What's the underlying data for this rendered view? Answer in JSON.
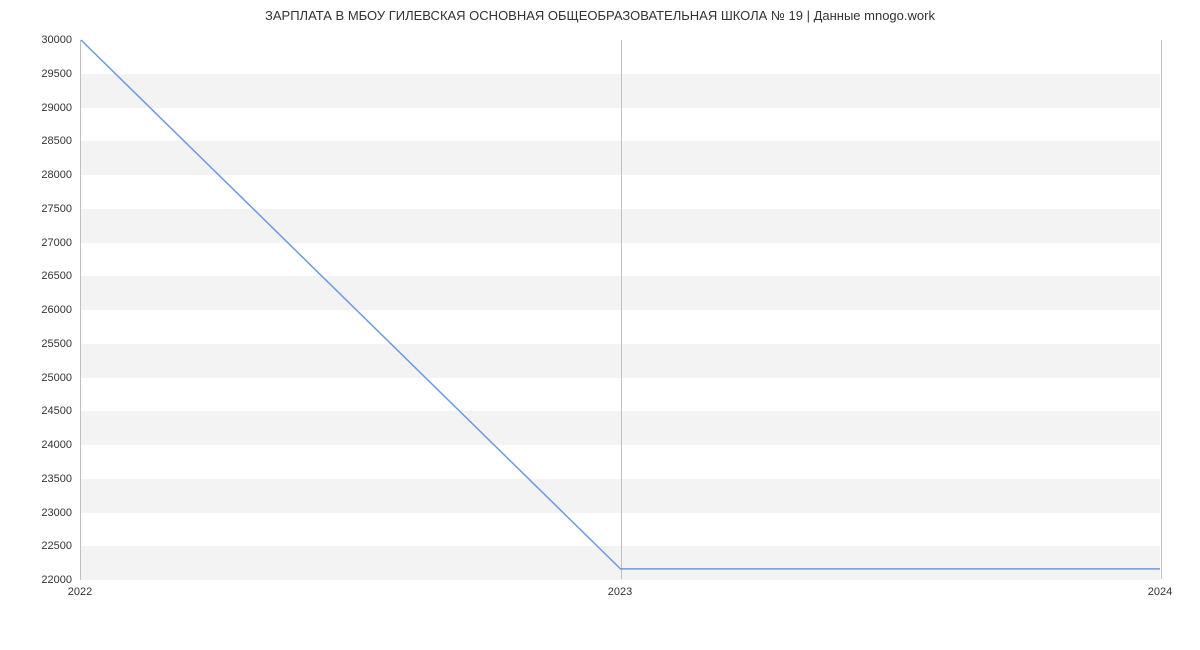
{
  "chart_data": {
    "type": "line",
    "title": "ЗАРПЛАТА В МБОУ ГИЛЕВСКАЯ ОСНОВНАЯ ОБЩЕОБРАЗОВАТЕЛЬНАЯ ШКОЛА № 19 | Данные mnogo.work",
    "xlabel": "",
    "ylabel": "",
    "x": [
      2022,
      2023,
      2024
    ],
    "xlim": [
      2022,
      2024
    ],
    "ylim": [
      22000,
      30000
    ],
    "y_ticks": [
      22000,
      22500,
      23000,
      23500,
      24000,
      24500,
      25000,
      25500,
      26000,
      26500,
      27000,
      27500,
      28000,
      28500,
      29000,
      29500,
      30000
    ],
    "x_ticks": [
      2022,
      2023,
      2024
    ],
    "series": [
      {
        "name": "salary",
        "values": [
          30000,
          22150,
          22150
        ]
      }
    ],
    "line_color": "#6a9ae6",
    "grid_band_color": "#f3f3f3"
  }
}
